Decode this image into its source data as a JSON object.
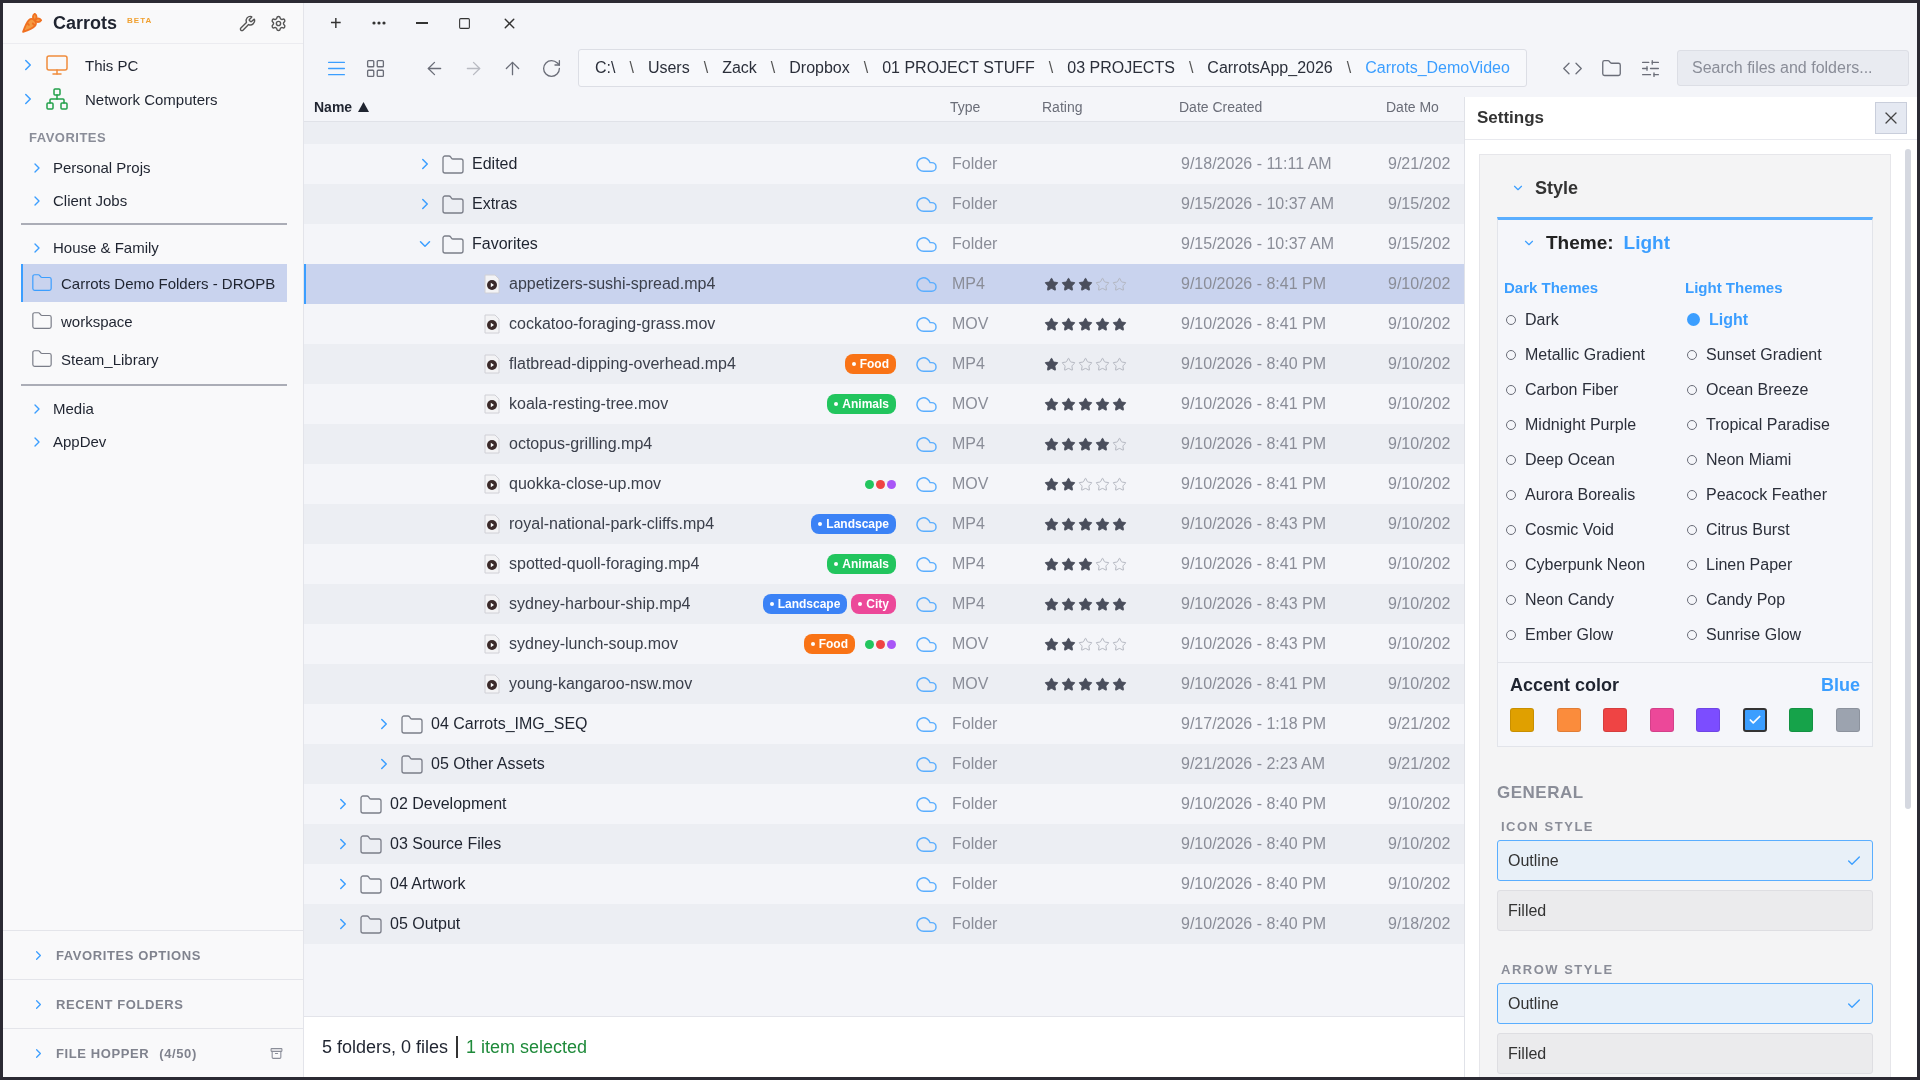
{
  "sidebar": {
    "app": {
      "name": "Carrots",
      "badge": "BETA"
    },
    "devices": [
      {
        "label": "This PC",
        "kind": "pc",
        "expanded": false
      },
      {
        "label": "Network Computers",
        "kind": "network",
        "expanded": false
      }
    ],
    "favorites": {
      "heading": "FAVORITES",
      "groups": [
        {
          "items": [
            {
              "label": "Personal Projs",
              "kind": "group",
              "selected": false
            },
            {
              "label": "Client Jobs",
              "kind": "group",
              "selected": false
            }
          ]
        },
        {
          "items": [
            {
              "label": "House & Family",
              "kind": "group",
              "selected": false
            },
            {
              "label": "Carrots Demo Folders - DROPB",
              "kind": "folder",
              "selected": true
            },
            {
              "label": "workspace",
              "kind": "folder",
              "selected": false
            },
            {
              "label": "Steam_Library",
              "kind": "folder",
              "selected": false
            }
          ]
        },
        {
          "items": [
            {
              "label": "Media",
              "kind": "group",
              "selected": false
            },
            {
              "label": "AppDev",
              "kind": "group",
              "selected": false
            }
          ]
        }
      ]
    },
    "sections": [
      {
        "label": "FAVORITES OPTIONS",
        "expanded": false
      },
      {
        "label": "RECENT FOLDERS",
        "expanded": false
      },
      {
        "label": "FILE HOPPER",
        "count": "(4/50)",
        "expanded": false
      }
    ]
  },
  "tab_bar": {
    "new_tab": "+"
  },
  "toolbar": {
    "views": [
      {
        "kind": "list",
        "selected": true
      },
      {
        "kind": "grid",
        "selected": false
      }
    ],
    "nav": [
      {
        "kind": "back",
        "disabled": false
      },
      {
        "kind": "forward",
        "disabled": true
      },
      {
        "kind": "up",
        "disabled": false
      },
      {
        "kind": "refresh",
        "disabled": false
      }
    ],
    "breadcrumb": {
      "separator": "\\",
      "segments": [
        {
          "label": "C:\\",
          "selected": false
        },
        {
          "label": "Users",
          "selected": false
        },
        {
          "label": "Zack",
          "selected": false
        },
        {
          "label": "Dropbox",
          "selected": false
        },
        {
          "label": "01 PROJECT STUFF",
          "selected": false
        },
        {
          "label": "03 PROJECTS",
          "selected": false
        },
        {
          "label": "CarrotsApp_2026",
          "selected": false
        },
        {
          "label": "Carrots_DemoVideo",
          "selected": true
        }
      ]
    },
    "search": {
      "placeholder": "Search files and folders..."
    }
  },
  "table": {
    "columns": [
      {
        "label": "Name",
        "sorted_ascending": true
      },
      {
        "label": "Type"
      },
      {
        "label": "Rating"
      },
      {
        "label": "Date Created"
      },
      {
        "label": "Date Mo"
      }
    ],
    "tree": [
      {
        "children": [
          {
            "children": [
              {
                "name": "Edited",
                "kind": "folder",
                "expanded": false,
                "selected": false,
                "type": "Folder",
                "created": "9/18/2026 - 11:11 AM",
                "modified": "9/21/202"
              },
              {
                "name": "Extras",
                "kind": "folder",
                "expanded": false,
                "selected": false,
                "type": "Folder",
                "created": "9/15/2026 - 10:37 AM",
                "modified": "9/15/202"
              },
              {
                "name": "Favorites",
                "kind": "folder",
                "expanded": true,
                "selected": false,
                "type": "Folder",
                "created": "9/15/2026 - 10:37 AM",
                "modified": "9/15/202",
                "children": [
                  {
                    "name": "appetizers-sushi-spread.mp4",
                    "kind": "video",
                    "selected": true,
                    "type": "MP4",
                    "stars": 3,
                    "created": "9/10/2026 - 8:41 PM",
                    "modified": "9/10/202"
                  },
                  {
                    "name": "cockatoo-foraging-grass.mov",
                    "kind": "video",
                    "selected": false,
                    "type": "MOV",
                    "stars": 5,
                    "created": "9/10/2026 - 8:41 PM",
                    "modified": "9/10/202"
                  },
                  {
                    "name": "flatbread-dipping-overhead.mp4",
                    "kind": "video",
                    "selected": false,
                    "type": "MP4",
                    "stars": 1,
                    "created": "9/10/2026 - 8:40 PM",
                    "modified": "9/10/202",
                    "tags": [
                      {
                        "label": "Food",
                        "color": "#f97316"
                      }
                    ]
                  },
                  {
                    "name": "koala-resting-tree.mov",
                    "kind": "video",
                    "selected": false,
                    "type": "MOV",
                    "stars": 5,
                    "created": "9/10/2026 - 8:41 PM",
                    "modified": "9/10/202",
                    "tags": [
                      {
                        "label": "Animals",
                        "color": "#22c55e"
                      }
                    ]
                  },
                  {
                    "name": "octopus-grilling.mp4",
                    "kind": "video",
                    "selected": false,
                    "type": "MP4",
                    "stars": 4,
                    "created": "9/10/2026 - 8:41 PM",
                    "modified": "9/10/202"
                  },
                  {
                    "name": "quokka-close-up.mov",
                    "kind": "video",
                    "selected": false,
                    "type": "MOV",
                    "stars": 2,
                    "created": "9/10/2026 - 8:41 PM",
                    "modified": "9/10/202",
                    "dots": [
                      {
                        "color": "#22c55e"
                      },
                      {
                        "color": "#ef4444"
                      },
                      {
                        "color": "#a855f7"
                      }
                    ]
                  },
                  {
                    "name": "royal-national-park-cliffs.mp4",
                    "kind": "video",
                    "selected": false,
                    "type": "MP4",
                    "stars": 5,
                    "created": "9/10/2026 - 8:43 PM",
                    "modified": "9/10/202",
                    "tags": [
                      {
                        "label": "Landscape",
                        "color": "#3b82f6"
                      }
                    ]
                  },
                  {
                    "name": "spotted-quoll-foraging.mp4",
                    "kind": "video",
                    "selected": false,
                    "type": "MP4",
                    "stars": 3,
                    "created": "9/10/2026 - 8:41 PM",
                    "modified": "9/10/202",
                    "tags": [
                      {
                        "label": "Animals",
                        "color": "#22c55e"
                      }
                    ]
                  },
                  {
                    "name": "sydney-harbour-ship.mp4",
                    "kind": "video",
                    "selected": false,
                    "type": "MP4",
                    "stars": 5,
                    "created": "9/10/2026 - 8:43 PM",
                    "modified": "9/10/202",
                    "tags": [
                      {
                        "label": "Landscape",
                        "color": "#3b82f6"
                      },
                      {
                        "label": "City",
                        "color": "#ec4899"
                      }
                    ]
                  },
                  {
                    "name": "sydney-lunch-soup.mov",
                    "kind": "video",
                    "selected": false,
                    "type": "MOV",
                    "stars": 2,
                    "created": "9/10/2026 - 8:43 PM",
                    "modified": "9/10/202",
                    "tags": [
                      {
                        "label": "Food",
                        "color": "#f97316"
                      }
                    ],
                    "dots": [
                      {
                        "color": "#22c55e"
                      },
                      {
                        "color": "#ef4444"
                      },
                      {
                        "color": "#a855f7"
                      }
                    ]
                  },
                  {
                    "name": "young-kangaroo-nsw.mov",
                    "kind": "video",
                    "selected": false,
                    "type": "MOV",
                    "stars": 5,
                    "created": "9/10/2026 - 8:41 PM",
                    "modified": "9/10/202"
                  }
                ]
              }
            ]
          },
          {
            "name": "04 Carrots_IMG_SEQ",
            "kind": "folder",
            "expanded": false,
            "selected": false,
            "type": "Folder",
            "created": "9/17/2026 - 1:18 PM",
            "modified": "9/21/202"
          },
          {
            "name": "05 Other Assets",
            "kind": "folder",
            "expanded": false,
            "selected": false,
            "type": "Folder",
            "created": "9/21/2026 - 2:23 AM",
            "modified": "9/21/202"
          }
        ]
      },
      {
        "name": "02 Development",
        "kind": "folder",
        "expanded": false,
        "selected": false,
        "type": "Folder",
        "created": "9/10/2026 - 8:40 PM",
        "modified": "9/10/202"
      },
      {
        "name": "03 Source Files",
        "kind": "folder",
        "expanded": false,
        "selected": false,
        "type": "Folder",
        "created": "9/10/2026 - 8:40 PM",
        "modified": "9/10/202"
      },
      {
        "name": "04 Artwork",
        "kind": "folder",
        "expanded": false,
        "selected": false,
        "type": "Folder",
        "created": "9/10/2026 - 8:40 PM",
        "modified": "9/10/202"
      },
      {
        "name": "05 Output",
        "kind": "folder",
        "expanded": false,
        "selected": false,
        "type": "Folder",
        "created": "9/10/2026 - 8:40 PM",
        "modified": "9/18/202"
      }
    ]
  },
  "status_bar": {
    "summary": "5 folders, 0 files",
    "selection": "1 item selected"
  },
  "settings": {
    "title": "Settings",
    "style": {
      "label": "Style",
      "expanded": true,
      "theme": {
        "label": "Theme:",
        "value": "Light",
        "expanded": true,
        "columns": [
          {
            "heading": "Dark Themes",
            "options": [
              {
                "label": "Dark",
                "selected": false
              },
              {
                "label": "Metallic Gradient",
                "selected": false
              },
              {
                "label": "Carbon Fiber",
                "selected": false
              },
              {
                "label": "Midnight Purple",
                "selected": false
              },
              {
                "label": "Deep Ocean",
                "selected": false
              },
              {
                "label": "Aurora Borealis",
                "selected": false
              },
              {
                "label": "Cosmic Void",
                "selected": false
              },
              {
                "label": "Cyberpunk Neon",
                "selected": false
              },
              {
                "label": "Neon Candy",
                "selected": false
              },
              {
                "label": "Ember Glow",
                "selected": false
              }
            ]
          },
          {
            "heading": "Light Themes",
            "options": [
              {
                "label": "Light",
                "selected": true
              },
              {
                "label": "Sunset Gradient",
                "selected": false
              },
              {
                "label": "Ocean Breeze",
                "selected": false
              },
              {
                "label": "Tropical Paradise",
                "selected": false
              },
              {
                "label": "Neon Miami",
                "selected": false
              },
              {
                "label": "Peacock Feather",
                "selected": false
              },
              {
                "label": "Citrus Burst",
                "selected": false
              },
              {
                "label": "Linen Paper",
                "selected": false
              },
              {
                "label": "Candy Pop",
                "selected": false
              },
              {
                "label": "Sunrise Glow",
                "selected": false
              }
            ]
          }
        ]
      },
      "accent": {
        "label": "Accent color",
        "value": "Blue",
        "swatches": [
          {
            "color": "#e0a000",
            "selected": false
          },
          {
            "color": "#fb8c3c",
            "selected": false
          },
          {
            "color": "#ef4444",
            "selected": false
          },
          {
            "color": "#ec4899",
            "selected": false
          },
          {
            "color": "#7c4dff",
            "selected": false
          },
          {
            "color": "#3b9eff",
            "selected": true
          },
          {
            "color": "#16a34a",
            "selected": false
          },
          {
            "color": "#9ca3af",
            "selected": false
          }
        ]
      }
    },
    "general": {
      "heading": "GENERAL",
      "groups": [
        {
          "label": "ICON STYLE",
          "options": [
            {
              "label": "Outline",
              "selected": true
            },
            {
              "label": "Filled",
              "selected": false
            }
          ]
        },
        {
          "label": "ARROW STYLE",
          "options": [
            {
              "label": "Outline",
              "selected": true
            },
            {
              "label": "Filled",
              "selected": false
            }
          ]
        }
      ]
    }
  }
}
